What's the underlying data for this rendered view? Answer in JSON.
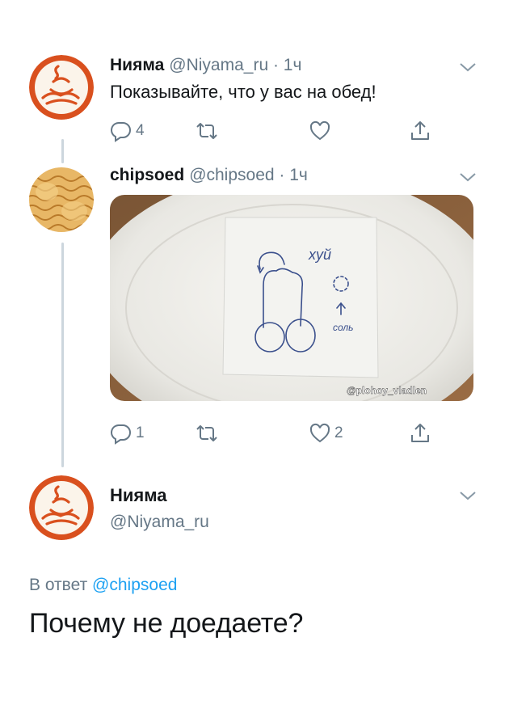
{
  "tweets": [
    {
      "author": "Нияма",
      "meta": "@Niyama_ru · 1ч",
      "text": "Показывайте, что у вас на обед!",
      "actions": {
        "reply_count": "4",
        "retweet_count": "",
        "like_count": ""
      }
    },
    {
      "author": "chipsoed",
      "meta": "@chipsoed · 1ч",
      "image": {
        "note_word": "хуй",
        "salt_word": "соль",
        "watermark": "@plohoy_vladlen"
      },
      "actions": {
        "reply_count": "1",
        "retweet_count": "",
        "like_count": "2"
      }
    }
  ],
  "focused_tweet": {
    "author": "Нияма",
    "handle": "@Niyama_ru",
    "reply_prefix": "В ответ ",
    "reply_mention": "@chipsoed",
    "text": "Почему не доедаете?"
  },
  "colors": {
    "text": "#14171a",
    "secondary": "#657786",
    "accent": "#1da1f2",
    "brand_logo": "#d9501e"
  },
  "icons": [
    "chevron-down-icon",
    "reply-icon",
    "retweet-icon",
    "like-icon",
    "share-icon"
  ]
}
